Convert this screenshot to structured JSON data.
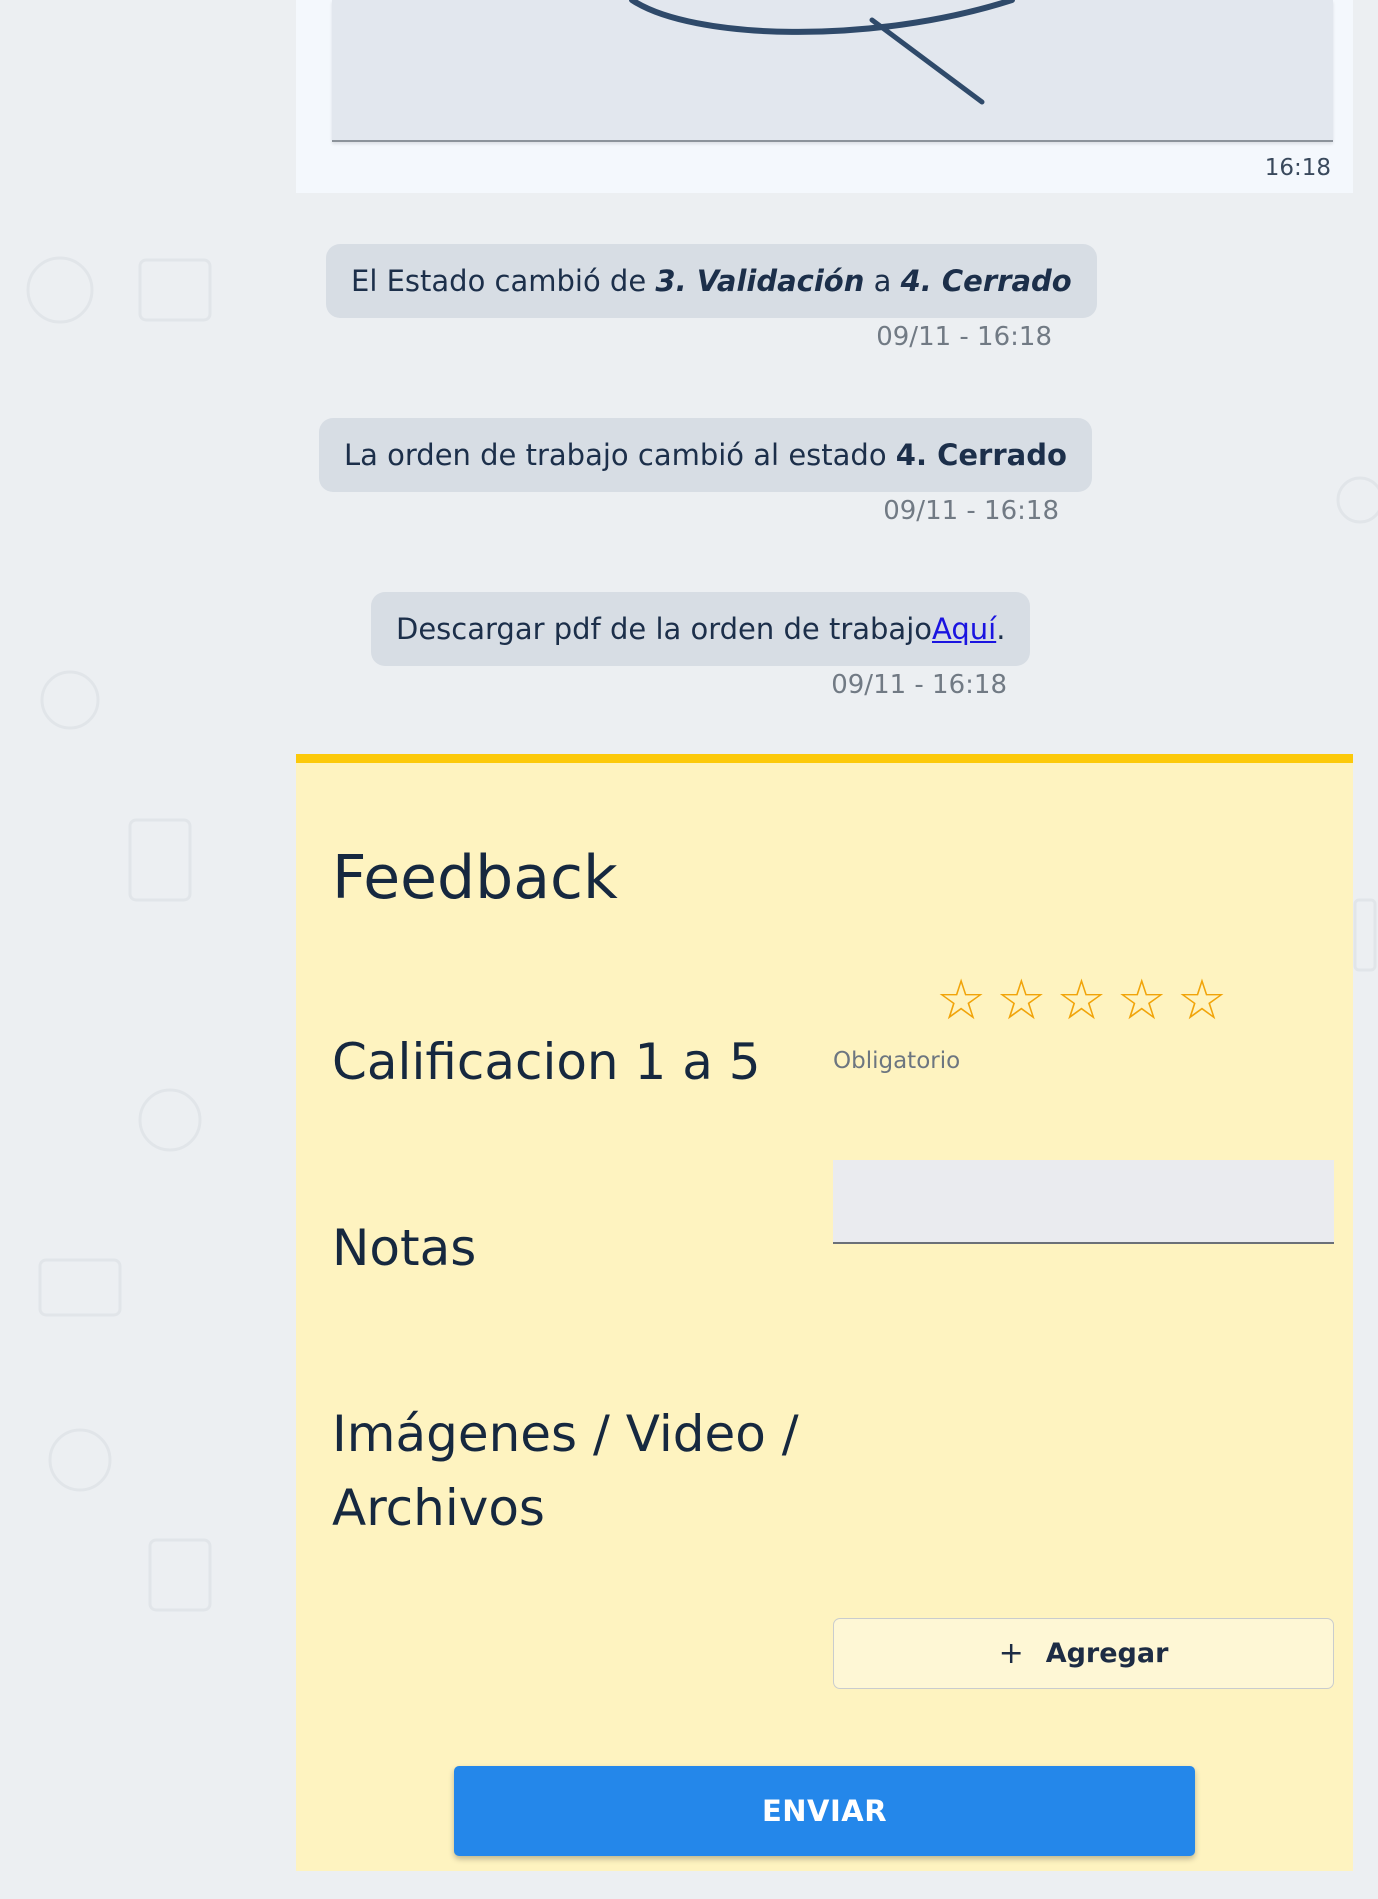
{
  "signature": {
    "time": "16:18"
  },
  "events": [
    {
      "text_before": "El Estado cambió de ",
      "bold1": "3. Validación",
      "text_mid": " a ",
      "bold2": "4. Cerrado",
      "time": "09/11 - 16:18"
    },
    {
      "text_before": "La orden de trabajo cambió al estado ",
      "bold": "4. Cerrado",
      "time": "09/11 - 16:18"
    },
    {
      "text_before": "Descargar pdf de la orden de trabajo",
      "link": "Aquí",
      "text_after": ".",
      "time": "09/11 - 16:18"
    }
  ],
  "feedback": {
    "title": "Feedback",
    "rating_label": "Calificacion 1 a 5",
    "rating_value": 0,
    "rating_max": 5,
    "star_glyph": "☆",
    "required_text": "Obligatorio",
    "notes_label": "Notas",
    "notes_value": "",
    "files_label_line1": "Imágenes / Video /",
    "files_label_line2": "Archivos",
    "add_label": "Agregar",
    "add_icon": "+",
    "send_label": "ENVIAR"
  },
  "colors": {
    "accent": "#fcc90a",
    "panel": "#fef3c0",
    "button": "#2487ea",
    "star": "#f1a40a",
    "link": "#1a14e0"
  }
}
